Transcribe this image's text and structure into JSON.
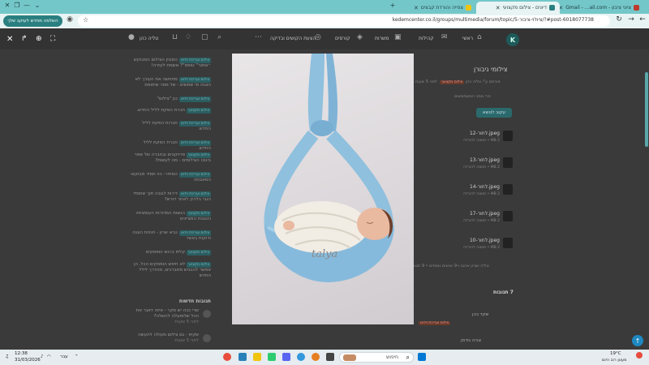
{
  "browser": {
    "tabs": [
      {
        "title": "ציוני ציבון - Gmail - ...ail.com",
        "color": "#c0392b"
      },
      {
        "title": "דיונים - צילום מקצועי",
        "color": "#2a7f80"
      },
      {
        "title": "צפייה והורדת קבצים",
        "color": "#f1c40f"
      }
    ],
    "new_tab": "+",
    "url": "kedemcenter.co.il/groups/multimedia/forum/topic/5-ציולוי-ציבור/?#post-6018077738",
    "complete_button": "השלמה מחדש לעוקב שלך"
  },
  "site": {
    "nav": [
      "ראשי",
      "קהילות",
      "משרות",
      "קורסים",
      "הצעת הקושים ובדיקה"
    ],
    "user_name": "טליה כהן"
  },
  "forum_list": [
    {
      "badge": "צילום ועריכת וידאו",
      "text": "המגזין הצילום המבוקש ״אתנר\" טופס\"? אשמח לעזרה!"
    },
    {
      "badge": "צילום ועריכת וידאו",
      "text": "מתחשה את העורך לא הוגנה מי שמשים - של מסר שיתופת"
    },
    {
      "badge": "צילום ועריכת וידאו",
      "text": "ננן \"צילום\""
    },
    {
      "badge": "צילום מקצועי",
      "text": "חברת הפקת לליל החדש."
    },
    {
      "badge": "צילום ועריכת וידאו",
      "text": "חברות הפקת לליל החדש."
    },
    {
      "badge": "צילום ועריכת וידאו",
      "text": "חברת הפקת לליל החדש."
    },
    {
      "badge": "צילום מקצועי",
      "text": "פרויקטים ובחברה של שפר בינוכו הצילומים - מה לעשות?"
    },
    {
      "badge": "צילום ועריכת וידאו",
      "text": "המחיר- היו תמיד מבוקש- המאבחה"
    },
    {
      "badge": "צילום ועריכת וידאו",
      "text": "דירות לגובה תוך שתמיד הגבי בלהק לאחר דורש?"
    },
    {
      "badge": "צילום מקצועי",
      "text": "הגשות המדורות העופציות והוגנות המציינים"
    },
    {
      "badge": "צילום ועריכת וידאו",
      "text": "נביא שרון - חנויות הצגה ודוקות באשר"
    },
    {
      "badge": "צילום מקצועי",
      "text": "קליפ כרגש הופסקים"
    },
    {
      "badge": "צילום מקצועי",
      "text": "לא חיפש הופסקים הכל. הן אפשר להבגיש מתברכים, מהדרך לילל החדש"
    }
  ],
  "updates": {
    "title": "תגובות חדשות",
    "items": [
      {
        "text": "שרי ככה יש סקר - איזה דאגר את הכל שלפועלה להשלה?",
        "time": "לפני 5 שעות"
      },
      {
        "text": "שקיפ - גם צילום מעולה להעשה",
        "time": "לפני 5 שעות"
      }
    ]
  },
  "topic": {
    "title": "צילומי ניבורן",
    "meta_author": "פורסם ע\"י טליה כהן",
    "meta_badge": "צילום מקצועי",
    "meta_time": "לפני 5 שעות",
    "subtitle": "פרי מפני המשתמשים",
    "follow_button": "עקוב לנושא",
    "files": [
      {
        "name": "12-לחור.jpeg",
        "size": "2 MB • תמונה להורדה"
      },
      {
        "name": "13-לחור.jpeg",
        "size": "2 MB • תמונה להורדה"
      },
      {
        "name": "14-לחור.jpeg",
        "size": "2 MB • תמונה להורדה"
      },
      {
        "name": "17-לחור.jpeg",
        "size": "2 MB • תמונה להורדה"
      },
      {
        "name": "10-לחור.jpeg",
        "size": "2 MB • תמונה להורדה"
      }
    ],
    "reactions": "טליה ושרון אהבו ו-9 אנשים נוספים • 9 תגובות",
    "responses_count": "7 תגובות",
    "reply_author": "שקד כהן",
    "reply_tag": "צילום ועריכת וידאו",
    "reply_author2": "צביה גודמן"
  },
  "lightbox": {
    "watermark": "talya"
  },
  "taskbar": {
    "search_placeholder": "חיפוש",
    "time": "12:38",
    "date": "31/03/2026",
    "lang": "עבר",
    "weather_temp": "19°C",
    "weather_desc": "מעונן רוב היום",
    "notification_count": "2"
  }
}
